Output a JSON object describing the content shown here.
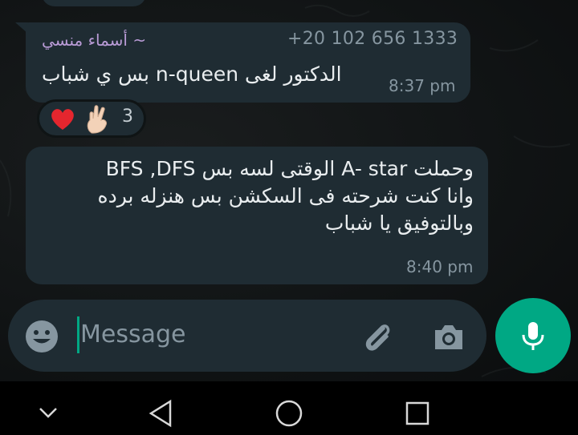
{
  "message1": {
    "sender": "~ أسماء منسي",
    "phone": "+20 102 656 1333",
    "text": "الدكتور لغى n-queen بس ي شباب",
    "time": "8:37 pm",
    "reactions": {
      "icons": [
        "red-heart-icon",
        "crossed-fingers-icon"
      ],
      "count": "3"
    }
  },
  "message2": {
    "lines": [
      "وحملت A- star الوقتى لسه بس BFS ,DFS",
      "وانا كنت شرحته فى السكشن بس هنزله برده",
      "وبالتوفيق يا شباب"
    ],
    "time": "8:40 pm"
  },
  "composer": {
    "placeholder": "Message",
    "icons": [
      "emoji-icon",
      "attach-icon",
      "camera-icon",
      "mic-icon"
    ]
  },
  "navbar": {
    "icons": [
      "chevron-down-icon",
      "back-triangle-icon",
      "home-circle-icon",
      "recents-square-icon"
    ]
  },
  "colors": {
    "bubble": "#1f2c33",
    "accent": "#00a884",
    "sender": "#b99bd6",
    "meta": "#8696a0"
  }
}
